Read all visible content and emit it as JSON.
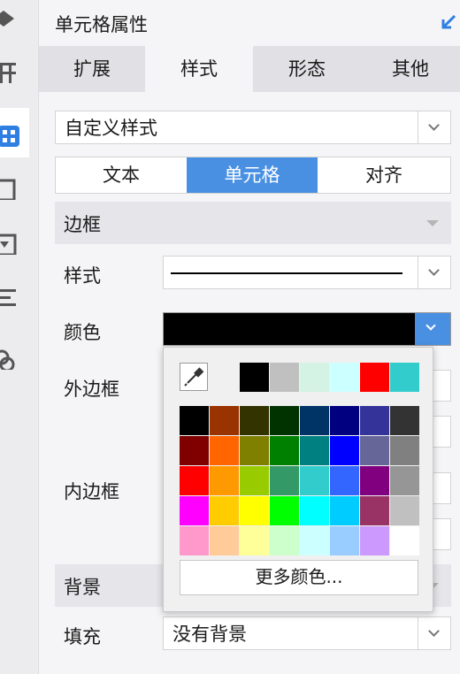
{
  "panel": {
    "title": "单元格属性"
  },
  "tabs": [
    "扩展",
    "样式",
    "形态",
    "其他"
  ],
  "style_select": {
    "value": "自定义样式"
  },
  "segments": [
    "文本",
    "单元格",
    "对齐"
  ],
  "border_section": {
    "title": "边框"
  },
  "labels": {
    "style": "样式",
    "color": "颜色",
    "outer": "外边框",
    "inner": "内边框"
  },
  "border_color": "#000000",
  "accent": "#4a90e2",
  "background_section": {
    "title": "背景"
  },
  "fill": {
    "label": "填充",
    "value": "没有背景"
  },
  "color_popup": {
    "recent_colors": [
      "#000000",
      "#c0c0c0",
      "#d4f3e4",
      "#ccffff",
      "#ff0000",
      "#33cccc"
    ],
    "grid": [
      [
        "#000000",
        "#993300",
        "#333300",
        "#003300",
        "#003366",
        "#000080",
        "#333399",
        "#333333"
      ],
      [
        "#800000",
        "#ff6600",
        "#808000",
        "#008000",
        "#008080",
        "#0000ff",
        "#666699",
        "#808080"
      ],
      [
        "#ff0000",
        "#ff9900",
        "#99cc00",
        "#339966",
        "#33cccc",
        "#3366ff",
        "#800080",
        "#969696"
      ],
      [
        "#ff00ff",
        "#ffcc00",
        "#ffff00",
        "#00ff00",
        "#00ffff",
        "#00ccff",
        "#993366",
        "#c0c0c0"
      ],
      [
        "#ff99cc",
        "#ffcc99",
        "#ffff99",
        "#ccffcc",
        "#ccffff",
        "#99ccff",
        "#cc99ff",
        "#ffffff"
      ]
    ],
    "more_label": "更多颜色..."
  }
}
